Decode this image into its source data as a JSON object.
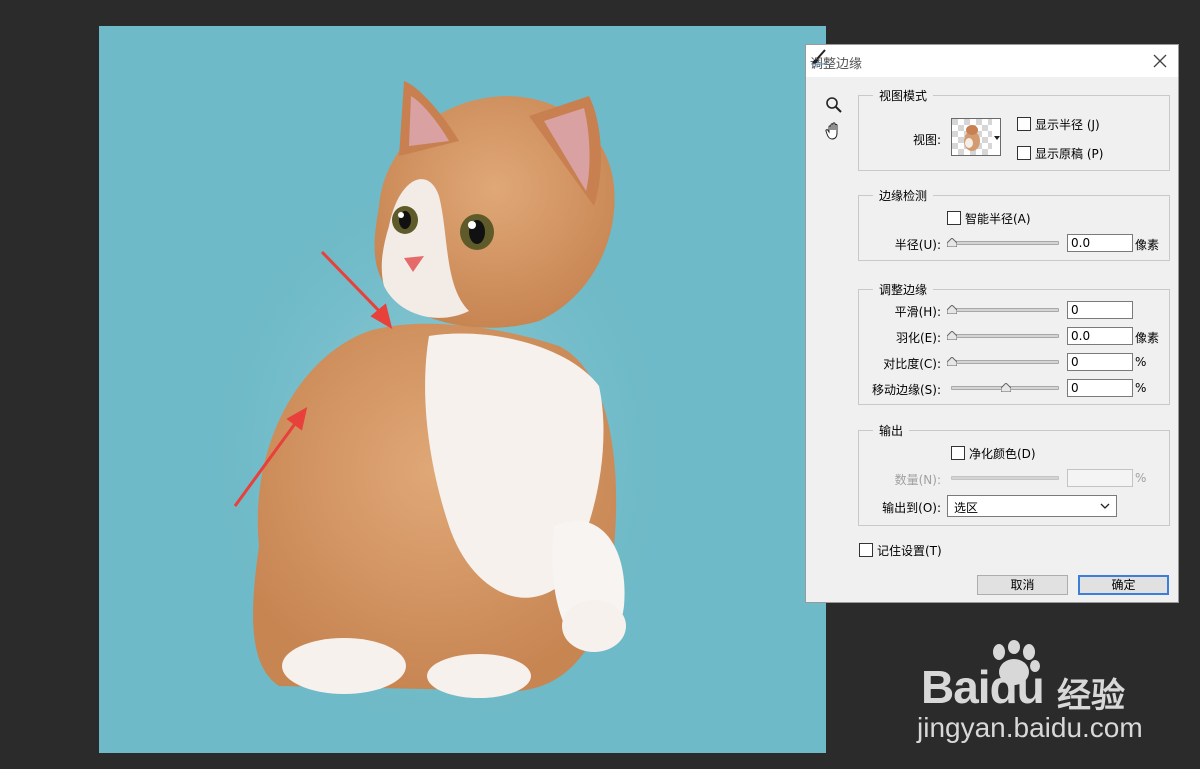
{
  "dialog": {
    "title": "调整边缘",
    "view_mode": {
      "legend": "视图模式",
      "view_label": "视图:",
      "show_radius": "显示半径 (J)",
      "show_original": "显示原稿 (P)"
    },
    "edge_detection": {
      "legend": "边缘检测",
      "smart_radius": "智能半径(A)",
      "radius_label": "半径(U):",
      "radius_value": "0.0",
      "radius_unit": "像素"
    },
    "adjust_edge": {
      "legend": "调整边缘",
      "smooth_label": "平滑(H):",
      "smooth_value": "0",
      "feather_label": "羽化(E):",
      "feather_value": "0.0",
      "feather_unit": "像素",
      "contrast_label": "对比度(C):",
      "contrast_value": "0",
      "contrast_unit": "%",
      "shift_label": "移动边缘(S):",
      "shift_value": "0",
      "shift_unit": "%"
    },
    "output": {
      "legend": "输出",
      "decontaminate": "净化颜色(D)",
      "amount_label": "数量(N):",
      "amount_value": "",
      "amount_unit": "%",
      "output_to_label": "输出到(O):",
      "output_to_value": "选区"
    },
    "remember": "记住设置(T)",
    "cancel": "取消",
    "ok": "确定"
  },
  "watermark": {
    "brand": "Baidu",
    "chinese": "经验",
    "url": "jingyan.baidu.com"
  },
  "colors": {
    "canvas_bg": "#6fbac8",
    "app_bg": "#2b2b2b",
    "dialog_bg": "#f0f0f0",
    "arrow": "#e8403a",
    "ok_border": "#3c7fd8"
  }
}
